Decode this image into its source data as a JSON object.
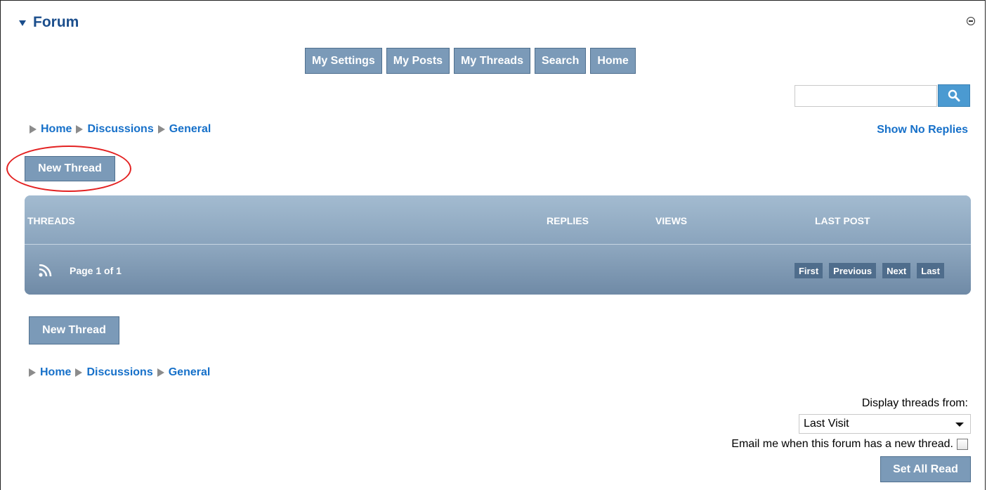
{
  "panel": {
    "title": "Forum"
  },
  "topnav": {
    "items": [
      {
        "label": "My Settings"
      },
      {
        "label": "My Posts"
      },
      {
        "label": "My Threads"
      },
      {
        "label": "Search"
      },
      {
        "label": "Home"
      }
    ]
  },
  "search": {
    "value": "",
    "placeholder": ""
  },
  "breadcrumb": {
    "items": [
      {
        "label": "Home"
      },
      {
        "label": "Discussions"
      },
      {
        "label": "General"
      }
    ]
  },
  "show_no_replies": "Show No Replies",
  "new_thread_label": "New Thread",
  "table": {
    "columns": [
      "THREADS",
      "REPLIES",
      "VIEWS",
      "LAST POST"
    ],
    "page_info": "Page 1 of 1",
    "pager": [
      "First",
      "Previous",
      "Next",
      "Last"
    ]
  },
  "bottom": {
    "display_label": "Display threads from:",
    "display_value": "Last Visit",
    "email_label": "Email me when this forum has a new thread.",
    "email_checked": false,
    "set_all_read": "Set All Read"
  },
  "colors": {
    "button_bg": "#7b9ab8",
    "link": "#1670c9",
    "title": "#1b4e8c",
    "highlight_ellipse": "#e32222"
  },
  "icons": [
    "collapse-icon",
    "search-icon",
    "rss-icon",
    "breadcrumb-arrow-icon",
    "select-caret-icon"
  ]
}
